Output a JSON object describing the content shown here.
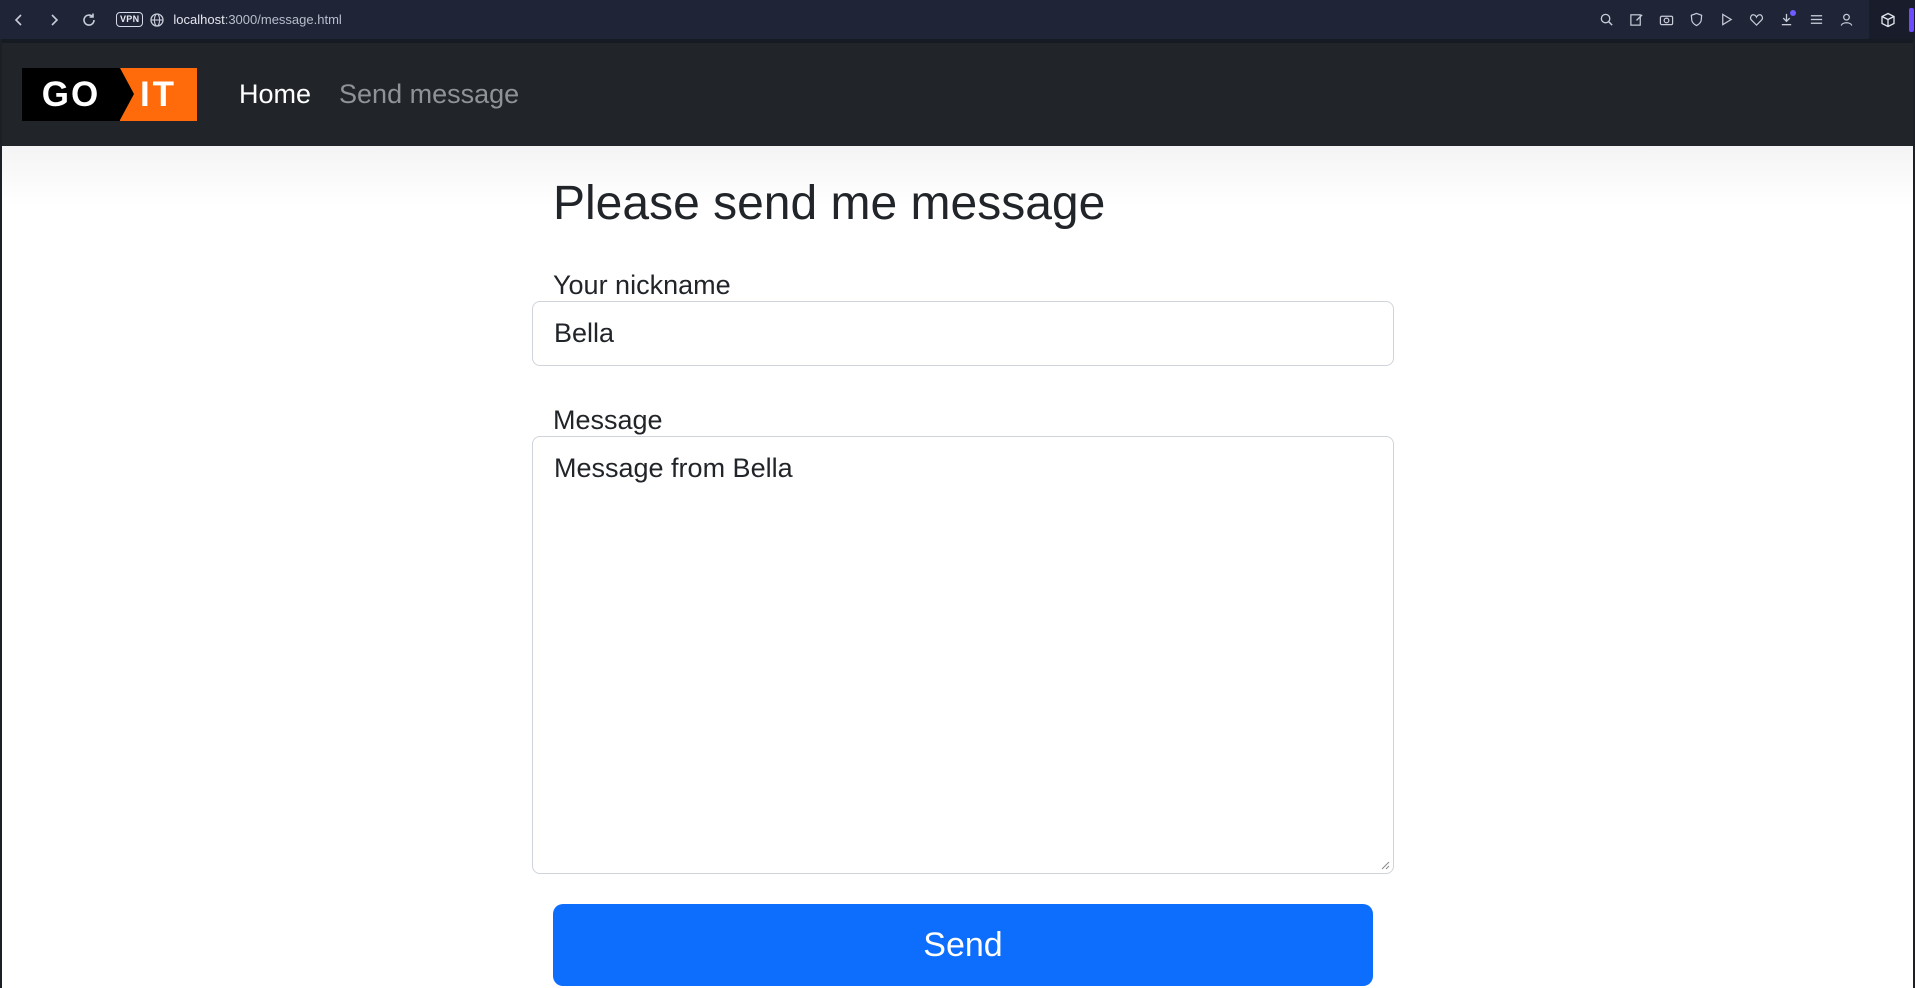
{
  "browser": {
    "url_host": "localhost",
    "url_rest": ":3000/message.html",
    "vpn_label": "VPN"
  },
  "navbar": {
    "logo_left": "GO",
    "logo_right": "IT",
    "links": [
      {
        "label": "Home"
      },
      {
        "label": "Send message"
      }
    ]
  },
  "form": {
    "title": "Please send me message",
    "nickname_label": "Your nickname",
    "nickname_value": "Bella",
    "message_label": "Message",
    "message_value": "Message from Bella",
    "submit_label": "Send"
  },
  "colors": {
    "primary": "#0d6efd",
    "navbar_bg": "#212529",
    "logo_orange": "#ff6b0a",
    "browser_bg": "#1f2437"
  },
  "icons": [
    "back-icon",
    "forward-icon",
    "reload-icon",
    "globe-icon",
    "search-icon",
    "edit-icon",
    "camera-icon",
    "shield-icon",
    "play-icon",
    "heart-icon",
    "download-icon",
    "menu-icon",
    "profile-icon",
    "cube-icon"
  ]
}
